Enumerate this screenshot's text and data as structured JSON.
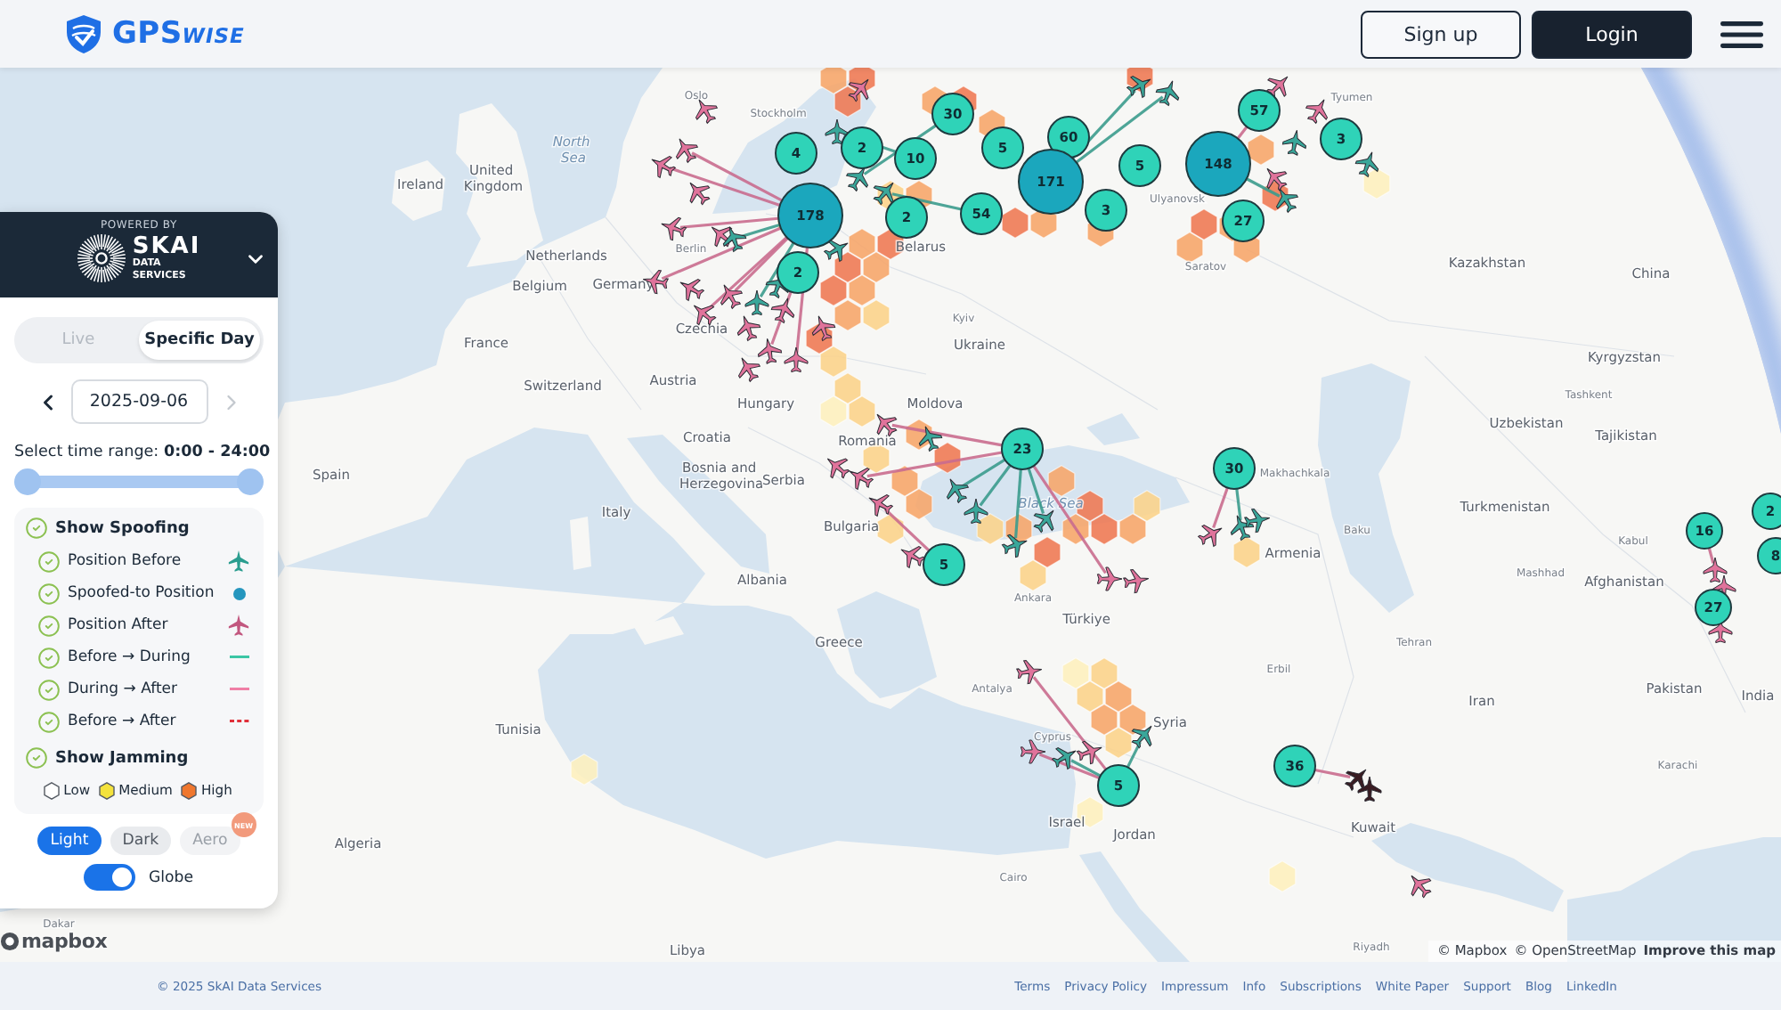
{
  "header": {
    "logo": {
      "main": "GPS",
      "suffix": "WISE"
    },
    "buttons": [
      {
        "label": "Sign up",
        "kind": "outline"
      },
      {
        "label": "Login",
        "kind": "filled"
      }
    ]
  },
  "panel": {
    "powered_by": "POWERED BY",
    "brand": {
      "name": "SKAI",
      "sub": "DATA SERVICES"
    },
    "mode_tabs": [
      {
        "label": "Live",
        "selected": false
      },
      {
        "label": "Specific Day",
        "selected": true
      }
    ],
    "date": {
      "value": "2025-09-06",
      "prev_disabled": false,
      "next_disabled": true
    },
    "time_range": {
      "label": "Select time range:",
      "value": "0:00 - 24:00",
      "level": 1
    },
    "spoofing": {
      "label": "Show Spoofing",
      "checked": true,
      "items": [
        {
          "label": "Position Before",
          "checked": true,
          "kind": "plane",
          "color": "#2a9d8f"
        },
        {
          "label": "Spoofed-to Position",
          "checked": true,
          "kind": "dot",
          "color": "#2596be"
        },
        {
          "label": "Position After",
          "checked": true,
          "kind": "plane",
          "color": "#c2577f"
        },
        {
          "label": "Before → During",
          "checked": true,
          "kind": "line",
          "color": "#3cc6a5"
        },
        {
          "label": "During → After",
          "checked": true,
          "kind": "line",
          "color": "#ef7fa6"
        },
        {
          "label": "Before → After",
          "checked": true,
          "kind": "dashed",
          "color": "#e0303a"
        }
      ]
    },
    "jamming": {
      "label": "Show Jamming",
      "checked": true,
      "legend": [
        {
          "label": "Low",
          "color": "#ffffff"
        },
        {
          "label": "Medium",
          "color": "#f4e23c"
        },
        {
          "label": "High",
          "color": "#f0772e"
        }
      ]
    },
    "themes": [
      {
        "label": "Light",
        "selected": true,
        "disabled": false
      },
      {
        "label": "Dark",
        "selected": false,
        "disabled": false
      },
      {
        "label": "Aero",
        "selected": false,
        "disabled": true,
        "badge": "NEW"
      }
    ],
    "globe": {
      "label": "Globe",
      "on": true
    }
  },
  "map": {
    "labels": [
      {
        "text": "Oslo",
        "kind": "city"
      },
      {
        "text": "Tyumen",
        "kind": "city"
      },
      {
        "text": "Stockholm",
        "kind": "city"
      },
      {
        "text": "North Sea",
        "kind": "sea"
      },
      {
        "text": "Ireland",
        "kind": "country"
      },
      {
        "text": "United Kingdom",
        "kind": "country"
      },
      {
        "text": "Ulyanovsk",
        "kind": "city"
      },
      {
        "text": "Belarus",
        "kind": "country"
      },
      {
        "text": "Netherlands",
        "kind": "country"
      },
      {
        "text": "Berlin",
        "kind": "city"
      },
      {
        "text": "Saratov",
        "kind": "city"
      },
      {
        "text": "Kazakhstan",
        "kind": "country"
      },
      {
        "text": "Belgium",
        "kind": "country"
      },
      {
        "text": "Germany",
        "kind": "country"
      },
      {
        "text": "China",
        "kind": "country"
      },
      {
        "text": "Czechia",
        "kind": "country"
      },
      {
        "text": "Kyiv",
        "kind": "city"
      },
      {
        "text": "France",
        "kind": "country"
      },
      {
        "text": "Ukraine",
        "kind": "country"
      },
      {
        "text": "Kyrgyzstan",
        "kind": "country"
      },
      {
        "text": "Switzerland",
        "kind": "country"
      },
      {
        "text": "Austria",
        "kind": "country"
      },
      {
        "text": "Hungary",
        "kind": "country"
      },
      {
        "text": "Moldova",
        "kind": "country"
      },
      {
        "text": "Tashkent",
        "kind": "city"
      },
      {
        "text": "Uzbekistan",
        "kind": "country"
      },
      {
        "text": "Croatia",
        "kind": "country"
      },
      {
        "text": "Romania",
        "kind": "country"
      },
      {
        "text": "Tajikistan",
        "kind": "country"
      },
      {
        "text": "Spain",
        "kind": "country"
      },
      {
        "text": "Bosnia and Herzegovina",
        "kind": "country"
      },
      {
        "text": "Serbia",
        "kind": "country"
      },
      {
        "text": "Makhachkala",
        "kind": "city"
      },
      {
        "text": "Italy",
        "kind": "country"
      },
      {
        "text": "Bulgaria",
        "kind": "country"
      },
      {
        "text": "Black Sea",
        "kind": "sea"
      },
      {
        "text": "Turkmenistan",
        "kind": "country"
      },
      {
        "text": "Armenia",
        "kind": "country"
      },
      {
        "text": "Baku",
        "kind": "city"
      },
      {
        "text": "Kabul",
        "kind": "city"
      },
      {
        "text": "Albania",
        "kind": "country"
      },
      {
        "text": "Mashhad",
        "kind": "city"
      },
      {
        "text": "Afghanistan",
        "kind": "country"
      },
      {
        "text": "Ankara",
        "kind": "city"
      },
      {
        "text": "Türkiye",
        "kind": "country"
      },
      {
        "text": "Greece",
        "kind": "country"
      },
      {
        "text": "Tehran",
        "kind": "city"
      },
      {
        "text": "Erbil",
        "kind": "city"
      },
      {
        "text": "Antalya",
        "kind": "city"
      },
      {
        "text": "Iran",
        "kind": "country"
      },
      {
        "text": "Pakistan",
        "kind": "country"
      },
      {
        "text": "India",
        "kind": "country"
      },
      {
        "text": "Tunisia",
        "kind": "country"
      },
      {
        "text": "Cyprus",
        "kind": "city"
      },
      {
        "text": "Syria",
        "kind": "country"
      },
      {
        "text": "Karachi",
        "kind": "city"
      },
      {
        "text": "Algeria",
        "kind": "country"
      },
      {
        "text": "Israel",
        "kind": "country"
      },
      {
        "text": "Jordan",
        "kind": "country"
      },
      {
        "text": "Kuwait",
        "kind": "country"
      },
      {
        "text": "Cairo",
        "kind": "city"
      },
      {
        "text": "Dakar",
        "kind": "city"
      },
      {
        "text": "Libya",
        "kind": "country"
      },
      {
        "text": "Riyadh",
        "kind": "city"
      }
    ],
    "clusters": [
      {
        "count": "4"
      },
      {
        "count": "2"
      },
      {
        "count": "10"
      },
      {
        "count": "30"
      },
      {
        "count": "5"
      },
      {
        "count": "60"
      },
      {
        "count": "5"
      },
      {
        "count": "148"
      },
      {
        "count": "57"
      },
      {
        "count": "3"
      },
      {
        "count": "178"
      },
      {
        "count": "2"
      },
      {
        "count": "54"
      },
      {
        "count": "171"
      },
      {
        "count": "3"
      },
      {
        "count": "27"
      },
      {
        "count": "2"
      },
      {
        "count": "23"
      },
      {
        "count": "30"
      },
      {
        "count": "16"
      },
      {
        "count": "2"
      },
      {
        "count": "5"
      },
      {
        "count": "8"
      },
      {
        "count": "27"
      },
      {
        "count": "5"
      },
      {
        "count": "36"
      }
    ],
    "logo": "mapbox",
    "attribution": [
      {
        "label": "© Mapbox",
        "kind": "link"
      },
      {
        "label": "© OpenStreetMap",
        "kind": "link"
      },
      {
        "label": "Improve this map",
        "kind": "strong"
      }
    ]
  },
  "footer": {
    "copyright": "© 2025 SkAI Data Services",
    "links": [
      "Terms",
      "Privacy Policy",
      "Impressum",
      "Info",
      "Subscriptions",
      "White Paper",
      "Support",
      "Blog",
      "LinkedIn"
    ]
  }
}
